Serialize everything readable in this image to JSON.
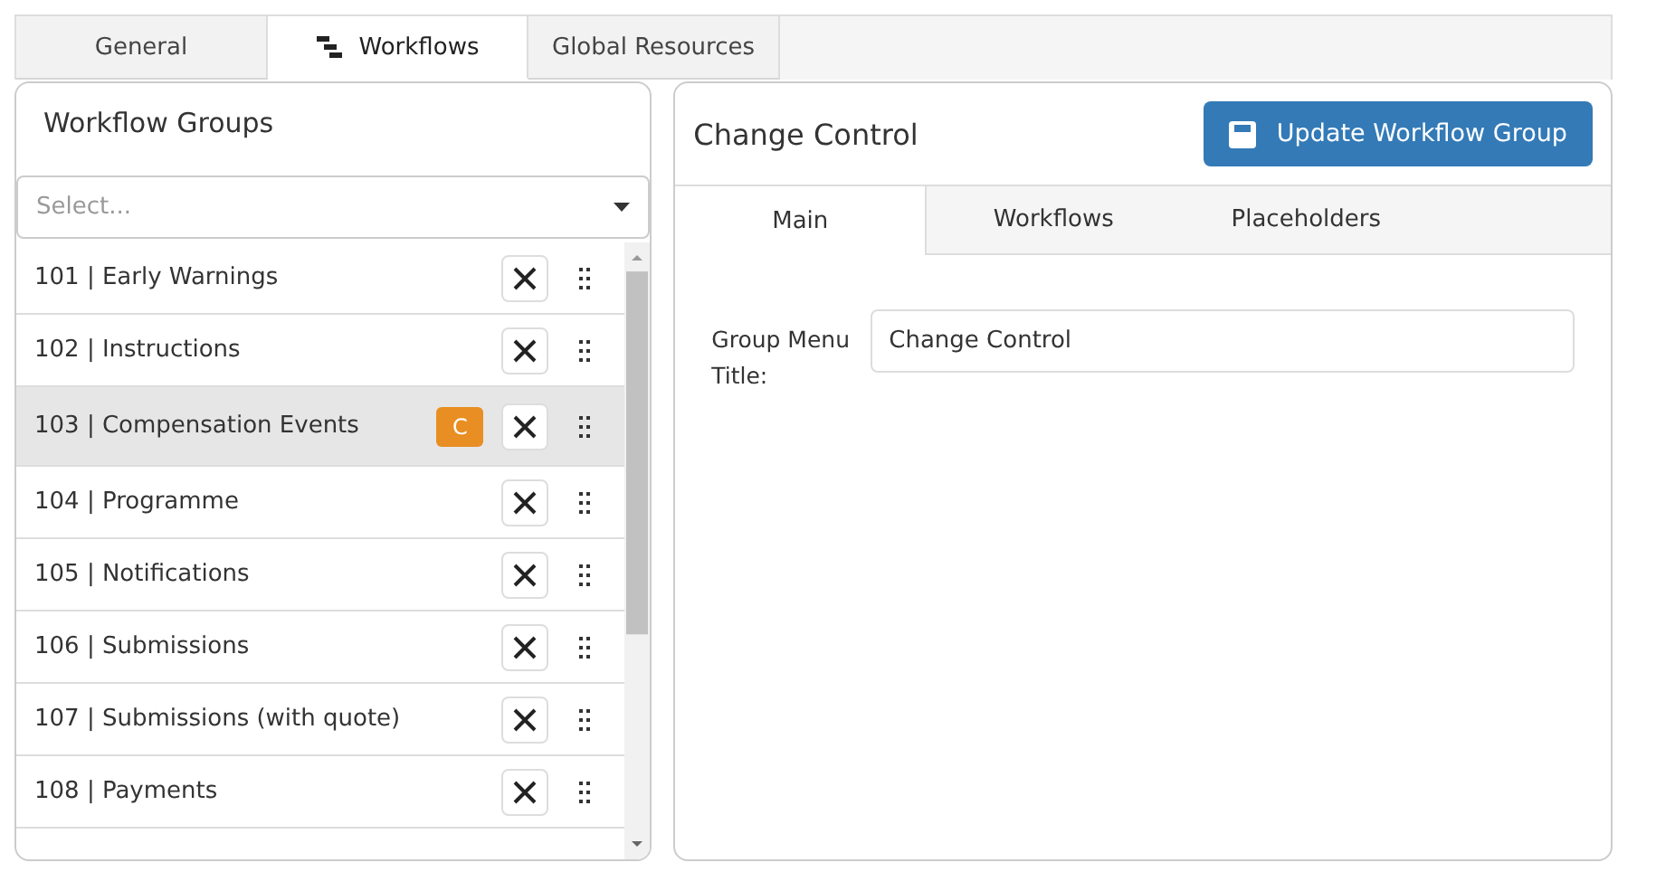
{
  "top_tabs": [
    {
      "label": "General",
      "selected": false,
      "has_icon": false
    },
    {
      "label": "Workflows",
      "selected": true,
      "has_icon": true
    },
    {
      "label": "Global Resources",
      "selected": false,
      "has_icon": false
    }
  ],
  "workflow_groups": {
    "title": "Workflow Groups",
    "select": {
      "placeholder": "Select..."
    },
    "items": [
      {
        "label": "101 | Early Warnings",
        "selected": false
      },
      {
        "label": "102 | Instructions",
        "selected": false
      },
      {
        "label": "103 | Compensation Events",
        "selected": true,
        "badge": "C"
      },
      {
        "label": "104 | Programme",
        "selected": false
      },
      {
        "label": "105 | Notifications",
        "selected": false
      },
      {
        "label": "106 | Submissions",
        "selected": false
      },
      {
        "label": "107 | Submissions (with quote)",
        "selected": false
      },
      {
        "label": "108 | Payments",
        "selected": false
      }
    ]
  },
  "detail": {
    "title": "Change Control",
    "button": "Update Workflow Group",
    "tabs": [
      {
        "label": "Main",
        "selected": true
      },
      {
        "label": "Workflows",
        "selected": false
      },
      {
        "label": "Placeholders",
        "selected": false
      }
    ],
    "fields": [
      {
        "label": "Group Menu Title:",
        "value": "Change Control"
      }
    ]
  }
}
